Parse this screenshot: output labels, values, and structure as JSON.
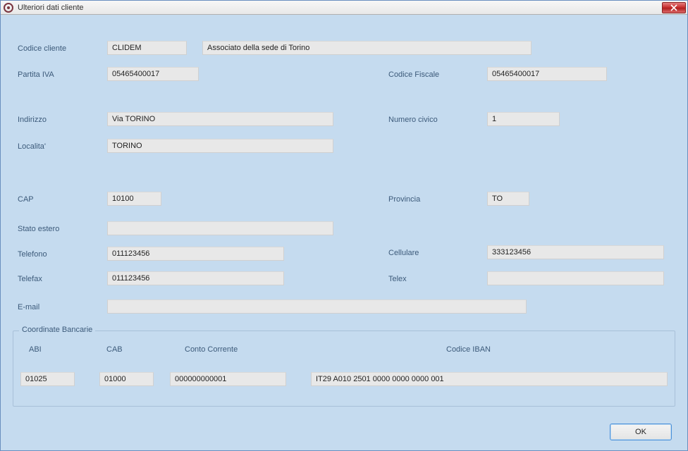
{
  "window": {
    "title": "Ulteriori dati cliente"
  },
  "fields": {
    "codice_cliente": {
      "label": "Codice cliente",
      "value": "CLIDEM"
    },
    "descrizione": {
      "value": "Associato della sede di Torino"
    },
    "partita_iva": {
      "label": "Partita IVA",
      "value": "05465400017"
    },
    "codice_fiscale": {
      "label": "Codice Fiscale",
      "value": "05465400017"
    },
    "indirizzo": {
      "label": "Indirizzo",
      "value": "Via TORINO"
    },
    "numero_civico": {
      "label": "Numero civico",
      "value": "1"
    },
    "localita": {
      "label": "Localita'",
      "value": "TORINO"
    },
    "cap": {
      "label": "CAP",
      "value": "10100"
    },
    "provincia": {
      "label": "Provincia",
      "value": "TO"
    },
    "stato_estero": {
      "label": "Stato estero",
      "value": ""
    },
    "telefono": {
      "label": "Telefono",
      "value": "011123456"
    },
    "cellulare": {
      "label": "Cellulare",
      "value": "333123456"
    },
    "telefax": {
      "label": "Telefax",
      "value": "011123456"
    },
    "telex": {
      "label": "Telex",
      "value": ""
    },
    "email": {
      "label": "E-mail",
      "value": ""
    }
  },
  "bank": {
    "legend": "Coordinate Bancarie",
    "abi": {
      "label": "ABI",
      "value": "01025"
    },
    "cab": {
      "label": "CAB",
      "value": "01000"
    },
    "conto": {
      "label": "Conto Corrente",
      "value": "000000000001"
    },
    "iban": {
      "label": "Codice IBAN",
      "value": "IT29 A010 2501 0000 0000 0000 001"
    }
  },
  "buttons": {
    "ok": "OK"
  }
}
